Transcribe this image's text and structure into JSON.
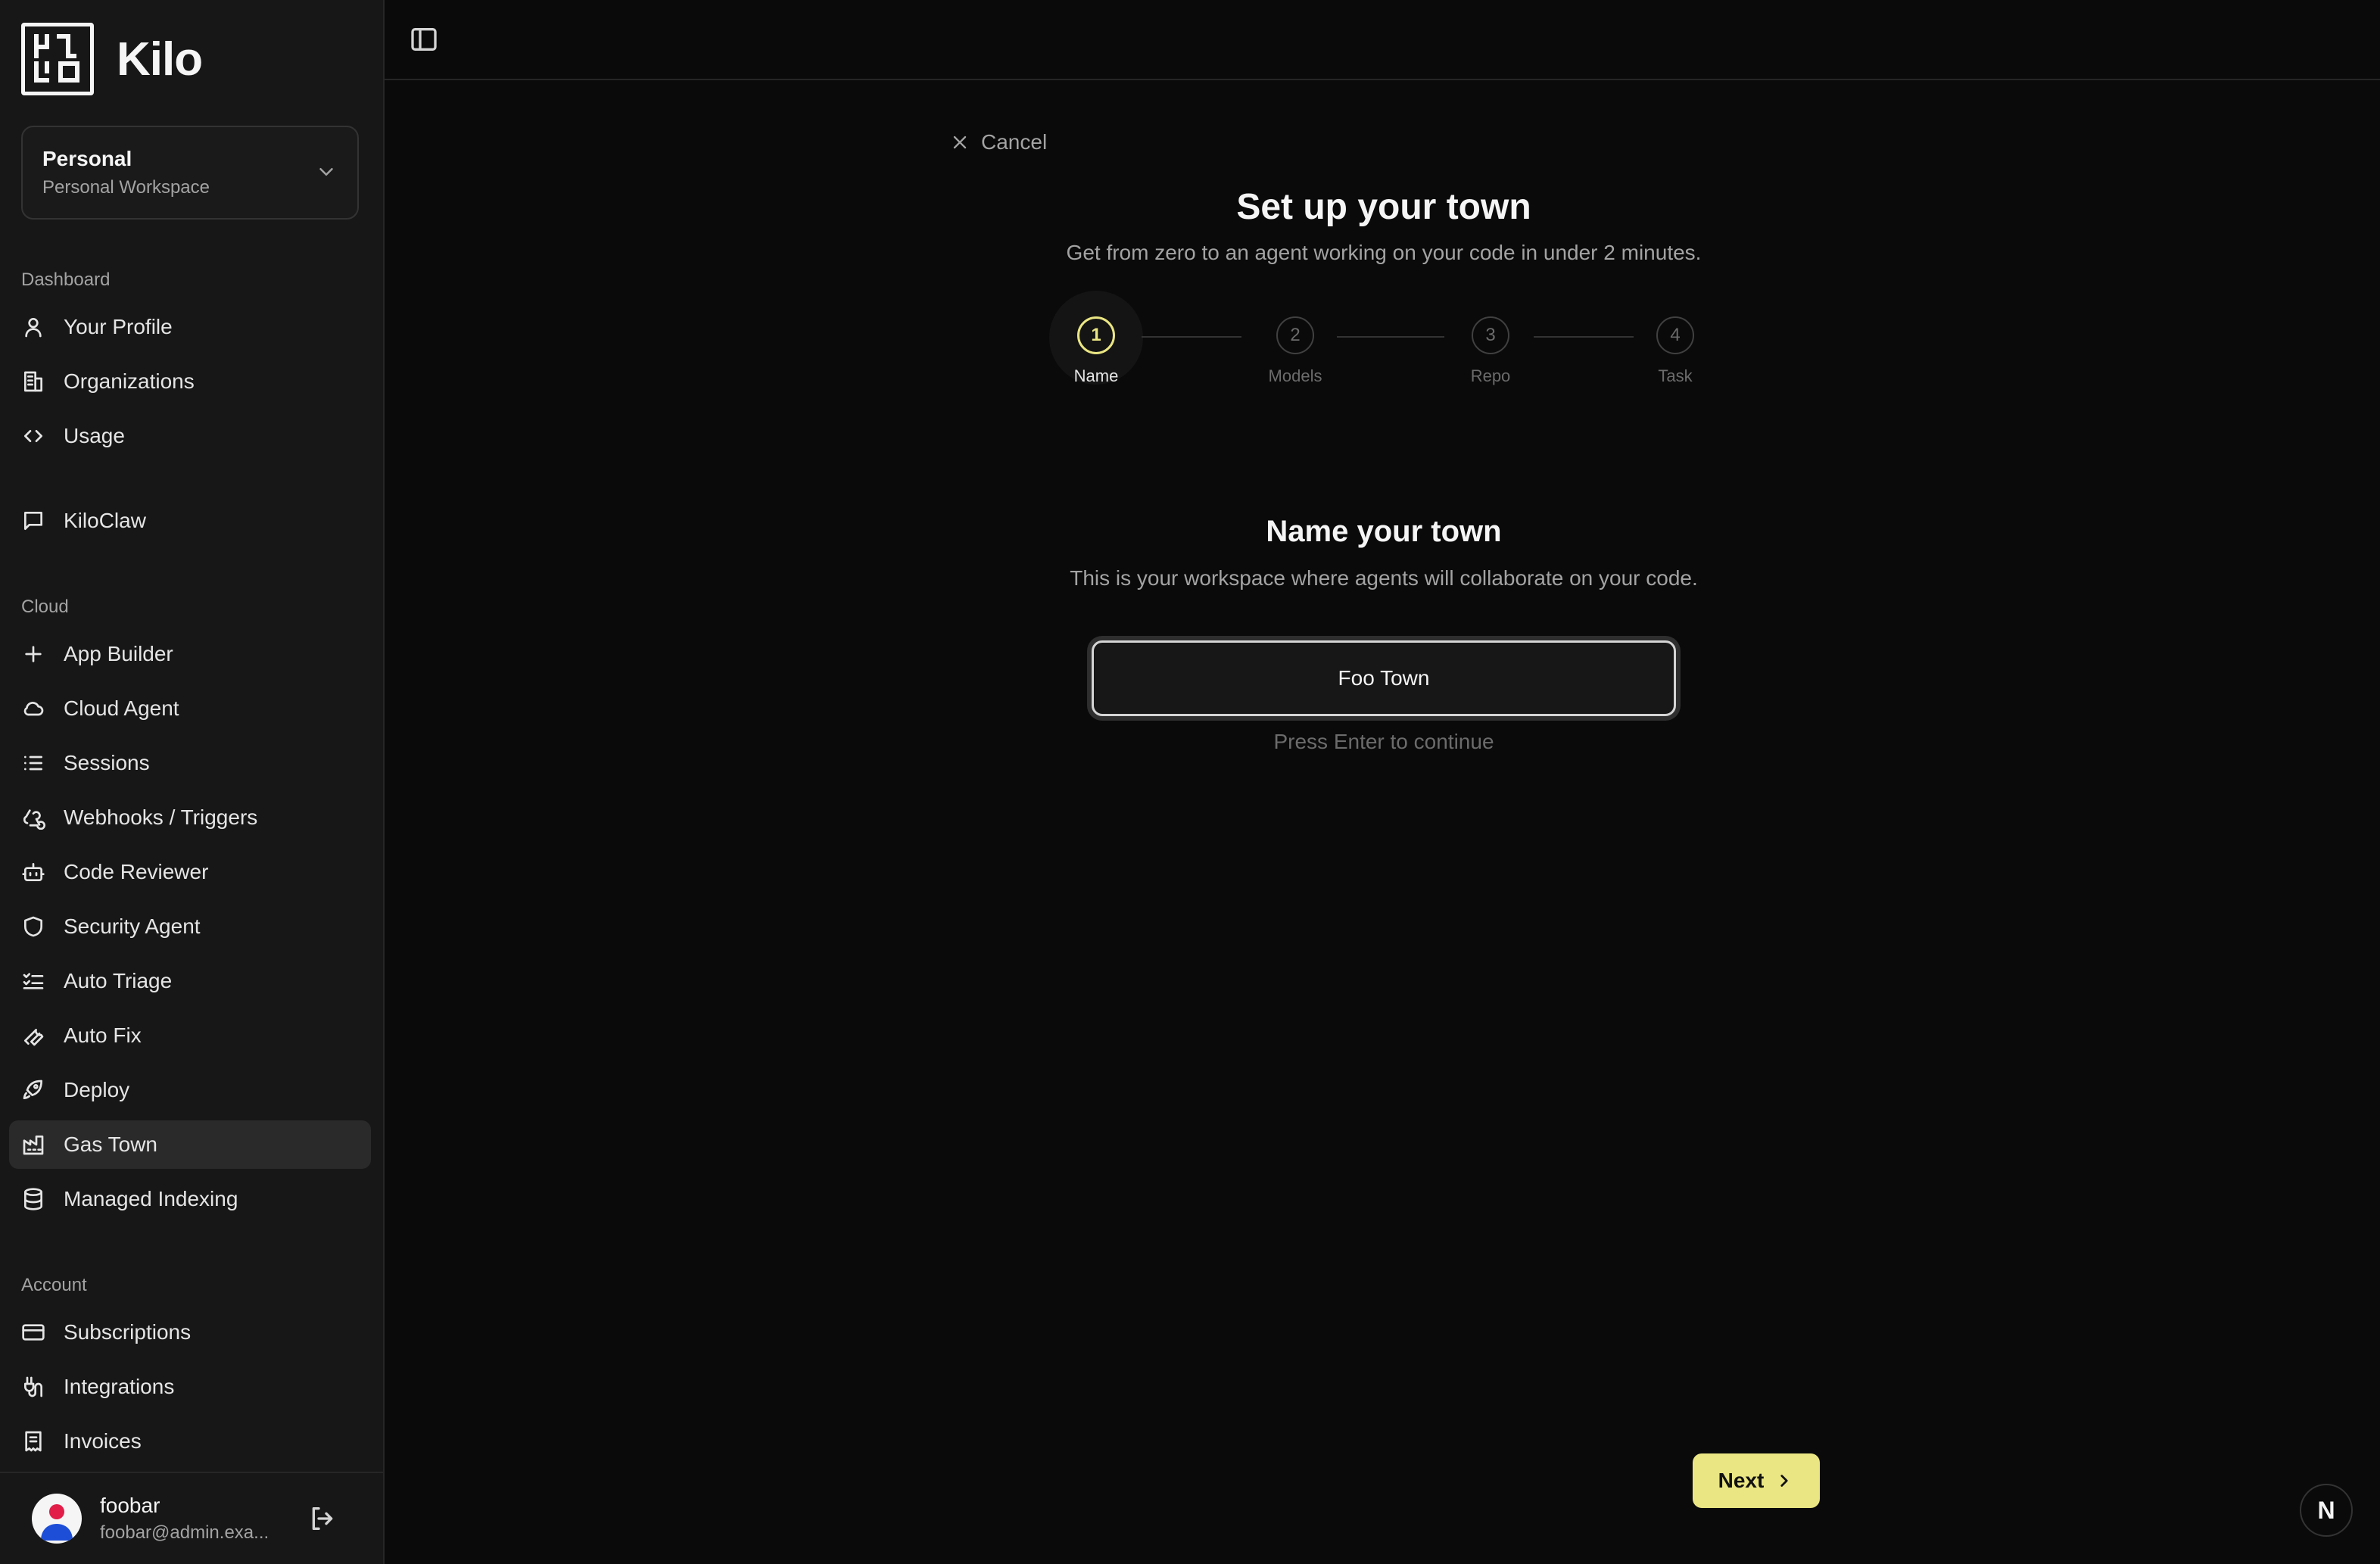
{
  "brand": {
    "name": "Kilo"
  },
  "workspace": {
    "title": "Personal",
    "subtitle": "Personal Workspace"
  },
  "sidebar": {
    "sections": {
      "dashboard": "Dashboard",
      "cloud": "Cloud",
      "account": "Account"
    },
    "dashboard_items": [
      {
        "label": "Your Profile",
        "icon": "user-icon"
      },
      {
        "label": "Organizations",
        "icon": "building-icon"
      },
      {
        "label": "Usage",
        "icon": "code-icon"
      }
    ],
    "kiloclaw": {
      "label": "KiloClaw",
      "icon": "message-square-icon"
    },
    "cloud_items": [
      {
        "label": "App Builder",
        "icon": "plus-icon"
      },
      {
        "label": "Cloud Agent",
        "icon": "cloud-icon"
      },
      {
        "label": "Sessions",
        "icon": "list-icon"
      },
      {
        "label": "Webhooks / Triggers",
        "icon": "webhook-icon"
      },
      {
        "label": "Code Reviewer",
        "icon": "bot-icon"
      },
      {
        "label": "Security Agent",
        "icon": "shield-icon"
      },
      {
        "label": "Auto Triage",
        "icon": "list-checks-icon"
      },
      {
        "label": "Auto Fix",
        "icon": "wrench-icon"
      },
      {
        "label": "Deploy",
        "icon": "rocket-icon"
      },
      {
        "label": "Gas Town",
        "icon": "factory-icon",
        "active": true
      },
      {
        "label": "Managed Indexing",
        "icon": "database-icon"
      }
    ],
    "account_items": [
      {
        "label": "Subscriptions",
        "icon": "credit-card-icon"
      },
      {
        "label": "Integrations",
        "icon": "plug-icon"
      },
      {
        "label": "Invoices",
        "icon": "receipt-icon"
      }
    ]
  },
  "user": {
    "name": "foobar",
    "email": "foobar@admin.exa..."
  },
  "wizard": {
    "cancel_label": "Cancel",
    "title": "Set up your town",
    "subtitle": "Get from zero to an agent working on your code in under 2 minutes.",
    "steps": [
      {
        "number": "1",
        "label": "Name",
        "current": true
      },
      {
        "number": "2",
        "label": "Models"
      },
      {
        "number": "3",
        "label": "Repo"
      },
      {
        "number": "4",
        "label": "Task"
      }
    ],
    "section_title": "Name your town",
    "section_subtitle": "This is your workspace where agents will collaborate on your code.",
    "input_value": "Foo Town",
    "hint": "Press Enter to continue",
    "next_label": "Next"
  },
  "badge": {
    "letter": "N"
  },
  "colors": {
    "accent": "#eae683",
    "background": "#0a0a0a",
    "sidebar": "#171717"
  }
}
